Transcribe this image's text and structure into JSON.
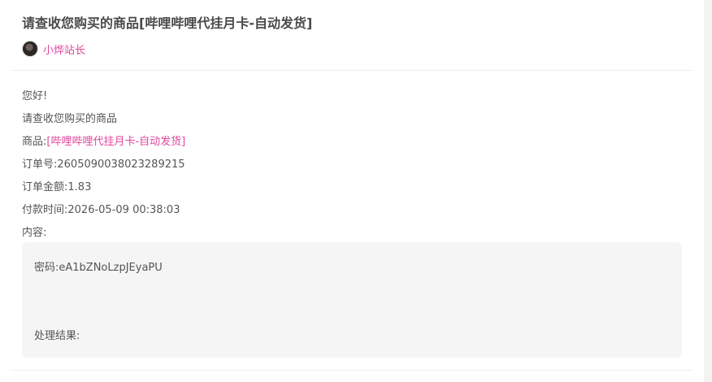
{
  "header": {
    "title": "请查收您购买的商品[哔哩哔哩代挂月卡-自动发货]",
    "author": "小烨站长"
  },
  "body": {
    "greeting": "您好!",
    "intro": "请查收您购买的商品",
    "product_label": "商品:",
    "product_value": "[哔哩哔哩代挂月卡-自动发货]",
    "order_no_label": "订单号:",
    "order_no": "2605090038023289215",
    "amount_label": "订单金额:",
    "amount": "1.83",
    "paid_time_label": "付款时间:",
    "paid_time": "2026-05-09 00:38:03",
    "content_label": "内容:"
  },
  "content_box": {
    "password_label": "密码:",
    "password": "eA1bZNoLzpJEyaPU",
    "result_label": "处理结果:",
    "result": ""
  },
  "colors": {
    "accent": "#e0479e",
    "text": "#555555",
    "box_bg": "#f5f5f5"
  }
}
